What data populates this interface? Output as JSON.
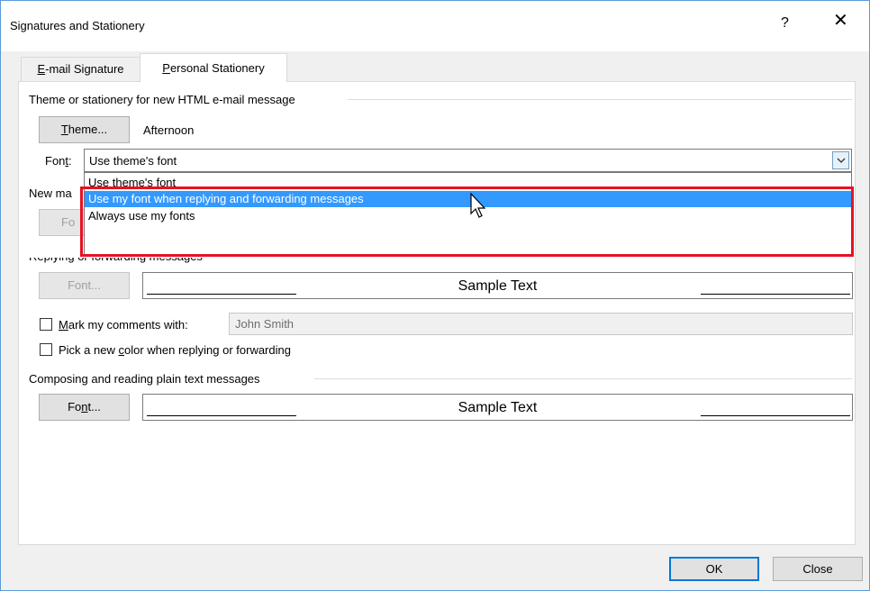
{
  "window": {
    "title": "Signatures and Stationery",
    "help": "?",
    "close": "✕"
  },
  "tabs": [
    {
      "prefix": "",
      "key": "E",
      "rest": "-mail Signature"
    },
    {
      "prefix": "",
      "key": "P",
      "rest": "ersonal Stationery"
    }
  ],
  "theme_section": {
    "label": "Theme or stationery for new HTML e-mail message",
    "theme_button": {
      "key": "T",
      "rest": "heme..."
    },
    "theme_value": "Afternoon",
    "font_label": {
      "prefix": "Fon",
      "key": "t",
      "rest": ":"
    },
    "font_select_value": "Use theme's font",
    "font_options": [
      "Use theme's font",
      "Use my font when replying and forwarding messages",
      "Always use my fonts"
    ],
    "selected_option_index": 1
  },
  "new_mail": {
    "label_partial": "New ma",
    "font_button_partial": "Fo"
  },
  "replying": {
    "label": "Replying or forwarding messages",
    "font_button": "Font...",
    "sample_text": "Sample Text",
    "mark_comments": {
      "prefix": "",
      "key": "M",
      "rest": "ark my comments with:"
    },
    "mark_comments_value": "John Smith",
    "pick_color": {
      "prefix": "Pick a new ",
      "key": "c",
      "rest": "olor when replying or forwarding"
    }
  },
  "plain_text": {
    "label": "Composing and reading plain text messages",
    "font_button": {
      "prefix": "Fo",
      "key": "n",
      "rest": "t..."
    },
    "sample_text": "Sample Text"
  },
  "footer": {
    "ok": "OK",
    "close": "Close"
  },
  "colors": {
    "accent": "#0078d7",
    "selection": "#3399ff",
    "highlight_box": "#e81123"
  }
}
